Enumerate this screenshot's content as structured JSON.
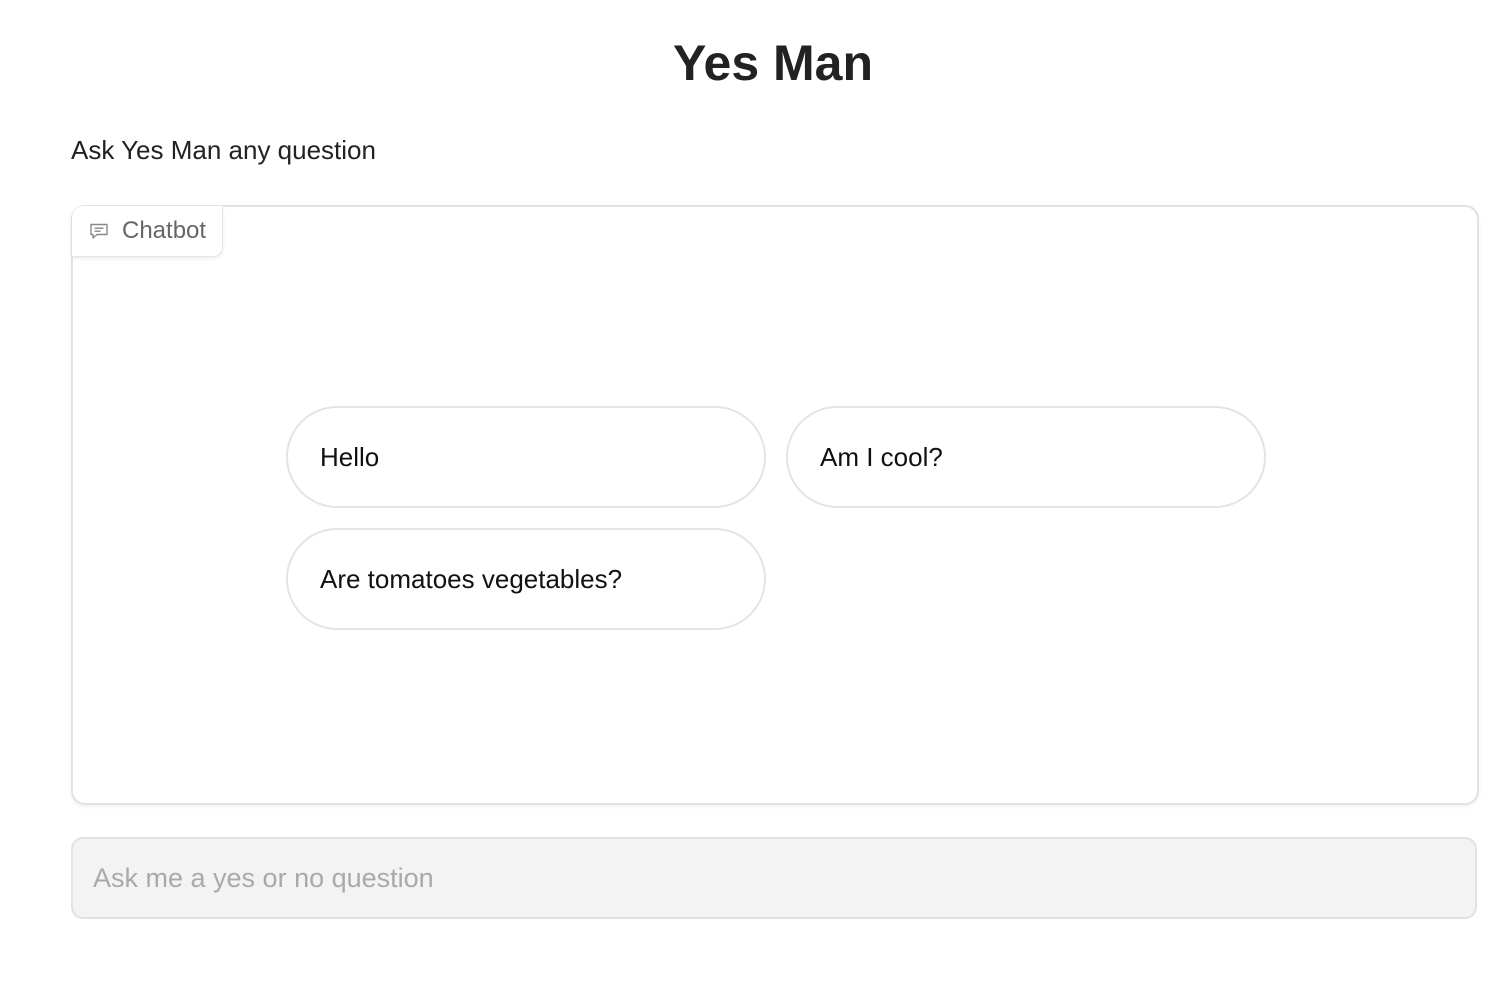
{
  "header": {
    "title": "Yes Man",
    "description": "Ask Yes Man any question"
  },
  "chatbot": {
    "label": "Chatbot",
    "icon": "chat-bubble-icon",
    "examples": [
      "Hello",
      "Am I cool?",
      "Are tomatoes vegetables?"
    ]
  },
  "input": {
    "value": "",
    "placeholder": "Ask me a yes or no question"
  },
  "colors": {
    "border": "#e2e2e2",
    "input_background": "#f3f3f3",
    "label_text": "#666666"
  }
}
